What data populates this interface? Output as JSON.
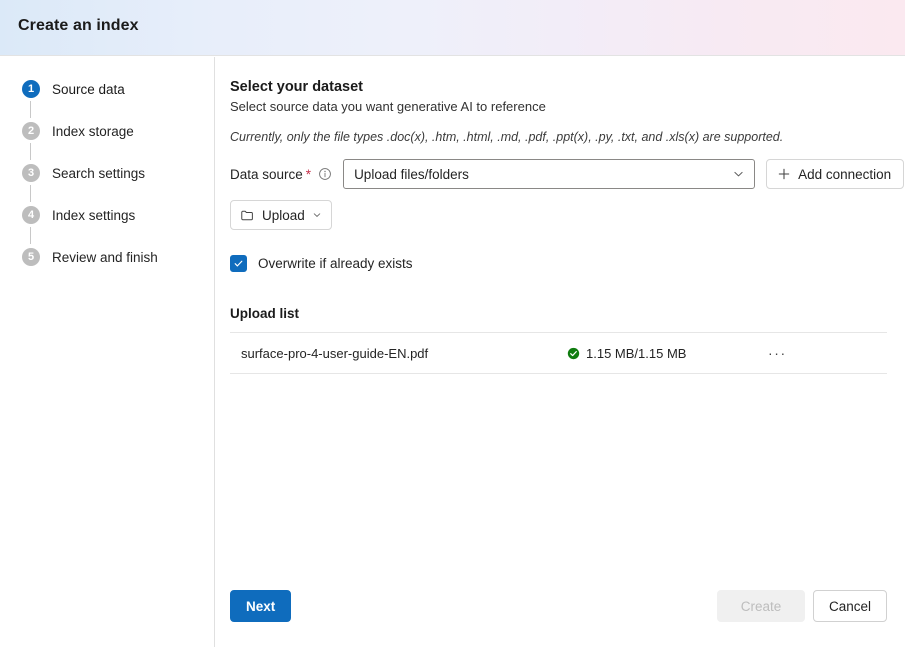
{
  "header": {
    "title": "Create an index",
    "gradient_from": "#dbe9f8",
    "gradient_to": "#fbe9f0"
  },
  "theme": {
    "accent": "#0f6cbd",
    "success": "#107c10",
    "required": "#c4314b",
    "border": "#d1d1d1"
  },
  "sidebar": {
    "steps": [
      {
        "number": "1",
        "label": "Source data",
        "state": "active"
      },
      {
        "number": "2",
        "label": "Index storage",
        "state": "inactive"
      },
      {
        "number": "3",
        "label": "Search settings",
        "state": "inactive"
      },
      {
        "number": "4",
        "label": "Index settings",
        "state": "inactive"
      },
      {
        "number": "5",
        "label": "Review and finish",
        "state": "inactive"
      }
    ]
  },
  "main": {
    "heading": "Select your dataset",
    "subheading": "Select source data you want generative AI to reference",
    "note": "Currently, only the file types .doc(x), .htm, .html, .md, .pdf, .ppt(x), .py, .txt, and .xls(x) are supported.",
    "data_source": {
      "label": "Data source",
      "required_marker": "*",
      "info_icon": "info-icon",
      "selected_value": "Upload files/folders",
      "chevron_icon": "chevron-down-icon",
      "add_connection_label": "Add connection",
      "add_connection_icon": "plus-icon"
    },
    "upload_button": {
      "label": "Upload",
      "icon": "folder-icon",
      "chevron_icon": "chevron-down-icon"
    },
    "overwrite": {
      "label": "Overwrite if already exists",
      "checked": true,
      "check_icon": "checkmark-icon"
    },
    "upload_list": {
      "title": "Upload list",
      "rows": [
        {
          "file_name": "surface-pro-4-user-guide-EN.pdf",
          "status_icon": "checkmark-circle-icon",
          "size": "1.15 MB/1.15 MB",
          "more_label": "···"
        }
      ]
    }
  },
  "footer": {
    "next_label": "Next",
    "create_label": "Create",
    "cancel_label": "Cancel"
  }
}
